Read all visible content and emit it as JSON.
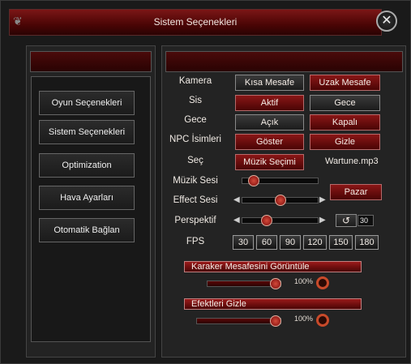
{
  "window": {
    "title": "Sistem Seçenekleri"
  },
  "menu": {
    "items": [
      {
        "label": "Oyun Seçenekleri"
      },
      {
        "label": "Sistem Seçenekleri"
      },
      {
        "label": "Optimization"
      },
      {
        "label": "Hava Ayarları"
      },
      {
        "label": "Otomatik Bağlan"
      }
    ]
  },
  "settings": {
    "kamera": {
      "label": "Kamera",
      "opt1": "Kısa Mesafe",
      "opt2": "Uzak Mesafe"
    },
    "sis": {
      "label": "Sis",
      "opt1": "Aktif",
      "opt2": "Gece"
    },
    "gece": {
      "label": "Gece",
      "opt1": "Açık",
      "opt2": "Kapalı"
    },
    "npc": {
      "label": "NPC İsimleri",
      "opt1": "Göster",
      "opt2": "Gizle"
    },
    "sec": {
      "label": "Seç",
      "button": "Müzik Seçimi",
      "file": "Wartune.mp3"
    },
    "muzik": {
      "label": "Müzik Sesi",
      "level": 0.1
    },
    "effect": {
      "label": "Effect Sesi",
      "level": 0.5,
      "button": "Pazar"
    },
    "perspektif": {
      "label": "Perspektif",
      "level": 0.3,
      "value": "30"
    },
    "fps": {
      "label": "FPS",
      "options": [
        "30",
        "60",
        "90",
        "120",
        "150",
        "180"
      ]
    }
  },
  "distance": {
    "label": "Karaker Mesafesini Görüntüle",
    "percent": "100%",
    "level": 1.0
  },
  "effects": {
    "label": "Efektleri Gizle",
    "percent": "100%",
    "level": 1.0
  },
  "colors": {
    "accent": "#7b1616",
    "panel": "#232323"
  }
}
